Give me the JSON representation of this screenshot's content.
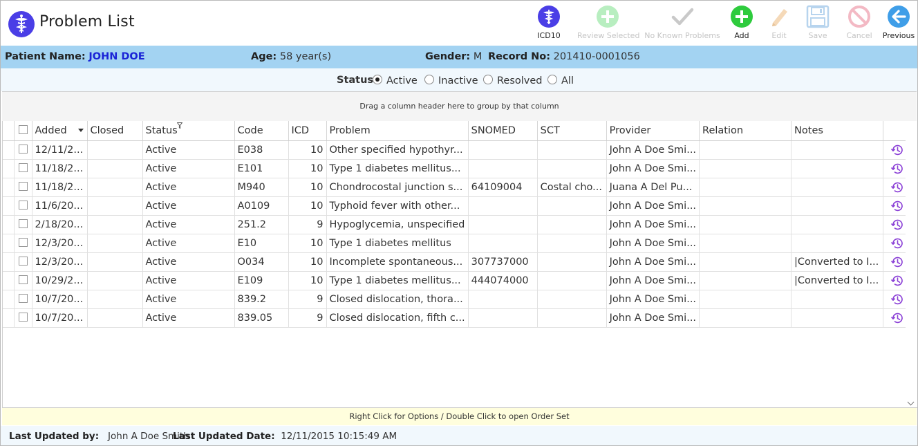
{
  "header": {
    "title": "Problem List",
    "toolbar": [
      {
        "id": "icd10",
        "label": "ICD10",
        "icon": "caduceus-icon",
        "enabled": true
      },
      {
        "id": "review",
        "label": "Review Selected",
        "icon": "plus-circle-icon",
        "enabled": false
      },
      {
        "id": "nkp",
        "label": "No Known Problems",
        "icon": "checkmark-icon",
        "enabled": false
      },
      {
        "id": "add",
        "label": "Add",
        "icon": "plus-circle-icon",
        "enabled": true
      },
      {
        "id": "edit",
        "label": "Edit",
        "icon": "pencil-icon",
        "enabled": false
      },
      {
        "id": "save",
        "label": "Save",
        "icon": "floppy-disk-icon",
        "enabled": false
      },
      {
        "id": "cancel",
        "label": "Cancel",
        "icon": "no-entry-icon",
        "enabled": false
      },
      {
        "id": "previous",
        "label": "Previous",
        "icon": "arrow-left-icon",
        "enabled": true
      }
    ]
  },
  "patient": {
    "name_label": "Patient Name:",
    "name": "JOHN DOE",
    "age_label": "Age:",
    "age": "58 year(s)",
    "gender_label": "Gender:",
    "gender": "M",
    "record_label": "Record No:",
    "record": "201410-0001056"
  },
  "status_filter": {
    "label": "Status:",
    "options": [
      "Active",
      "Inactive",
      "Resolved",
      "All"
    ],
    "selected": "Active"
  },
  "grid": {
    "group_hint": "Drag a column header here to group by that column",
    "columns": [
      "Added",
      "Closed",
      "Status",
      "Code",
      "ICD",
      "Problem",
      "SNOMED",
      "SCT",
      "Provider",
      "Relation",
      "Notes"
    ],
    "rows": [
      {
        "added": "12/11/2...",
        "closed": "",
        "status": "Active",
        "code": "E038",
        "icd": "10",
        "problem": "Other specified hypothyr...",
        "snomed": "",
        "sct": "",
        "provider": "John A Doe Smi...",
        "relation": "",
        "notes": ""
      },
      {
        "added": "11/18/2...",
        "closed": "",
        "status": "Active",
        "code": "E101",
        "icd": "10",
        "problem": "Type 1 diabetes mellitus...",
        "snomed": "",
        "sct": "",
        "provider": "John A Doe Smi...",
        "relation": "",
        "notes": ""
      },
      {
        "added": "11/18/2...",
        "closed": "",
        "status": "Active",
        "code": "M940",
        "icd": "10",
        "problem": "Chondrocostal junction s...",
        "snomed": "64109004",
        "sct": "Costal cho...",
        "provider": "Juana A Del Pu...",
        "relation": "",
        "notes": ""
      },
      {
        "added": "11/6/20...",
        "closed": "",
        "status": "Active",
        "code": "A0109",
        "icd": "10",
        "problem": "Typhoid fever with other...",
        "snomed": "",
        "sct": "",
        "provider": "John A Doe Smi...",
        "relation": "",
        "notes": ""
      },
      {
        "added": "2/18/20...",
        "closed": "",
        "status": "Active",
        "code": "251.2",
        "icd": "9",
        "problem": "Hypoglycemia, unspecified",
        "snomed": "",
        "sct": "",
        "provider": "John A Doe Smi...",
        "relation": "",
        "notes": ""
      },
      {
        "added": "12/3/20...",
        "closed": "",
        "status": "Active",
        "code": "E10",
        "icd": "10",
        "problem": "Type 1 diabetes mellitus",
        "snomed": "",
        "sct": "",
        "provider": "John A Doe Smi...",
        "relation": "",
        "notes": ""
      },
      {
        "added": "12/3/20...",
        "closed": "",
        "status": "Active",
        "code": "O034",
        "icd": "10",
        "problem": "Incomplete spontaneous...",
        "snomed": "307737000",
        "sct": "",
        "provider": "John A Doe Smi...",
        "relation": "",
        "notes": "|Converted to I..."
      },
      {
        "added": "10/29/2...",
        "closed": "",
        "status": "Active",
        "code": "E109",
        "icd": "10",
        "problem": "Type 1 diabetes mellitus...",
        "snomed": "444074000",
        "sct": "",
        "provider": "John A Doe Smi...",
        "relation": "",
        "notes": "|Converted to I..."
      },
      {
        "added": "10/7/20...",
        "closed": "",
        "status": "Active",
        "code": "839.2",
        "icd": "9",
        "problem": "Closed dislocation, thora...",
        "snomed": "",
        "sct": "",
        "provider": "John A Doe Smi...",
        "relation": "",
        "notes": ""
      },
      {
        "added": "10/7/20...",
        "closed": "",
        "status": "Active",
        "code": "839.05",
        "icd": "9",
        "problem": "Closed dislocation, fifth c...",
        "snomed": "",
        "sct": "",
        "provider": "John A Doe Smi...",
        "relation": "",
        "notes": ""
      }
    ]
  },
  "hint": "Right Click for Options / Double Click to open Order Set",
  "footer": {
    "updated_by_label": "Last Updated by:",
    "updated_by": "John A Doe Smith",
    "updated_date_label": "Last Updated Date:",
    "updated_date": "12/11/2015 10:15:49 AM"
  },
  "colors": {
    "patient_bar": "#a3d3f2",
    "patient_name": "#1a23d6",
    "logo": "#4a3ee6",
    "add_green": "#2ecb3d",
    "previous_blue": "#3f9ee8",
    "history_purple": "#8a3fd6",
    "hint_bg": "#fffedd"
  }
}
